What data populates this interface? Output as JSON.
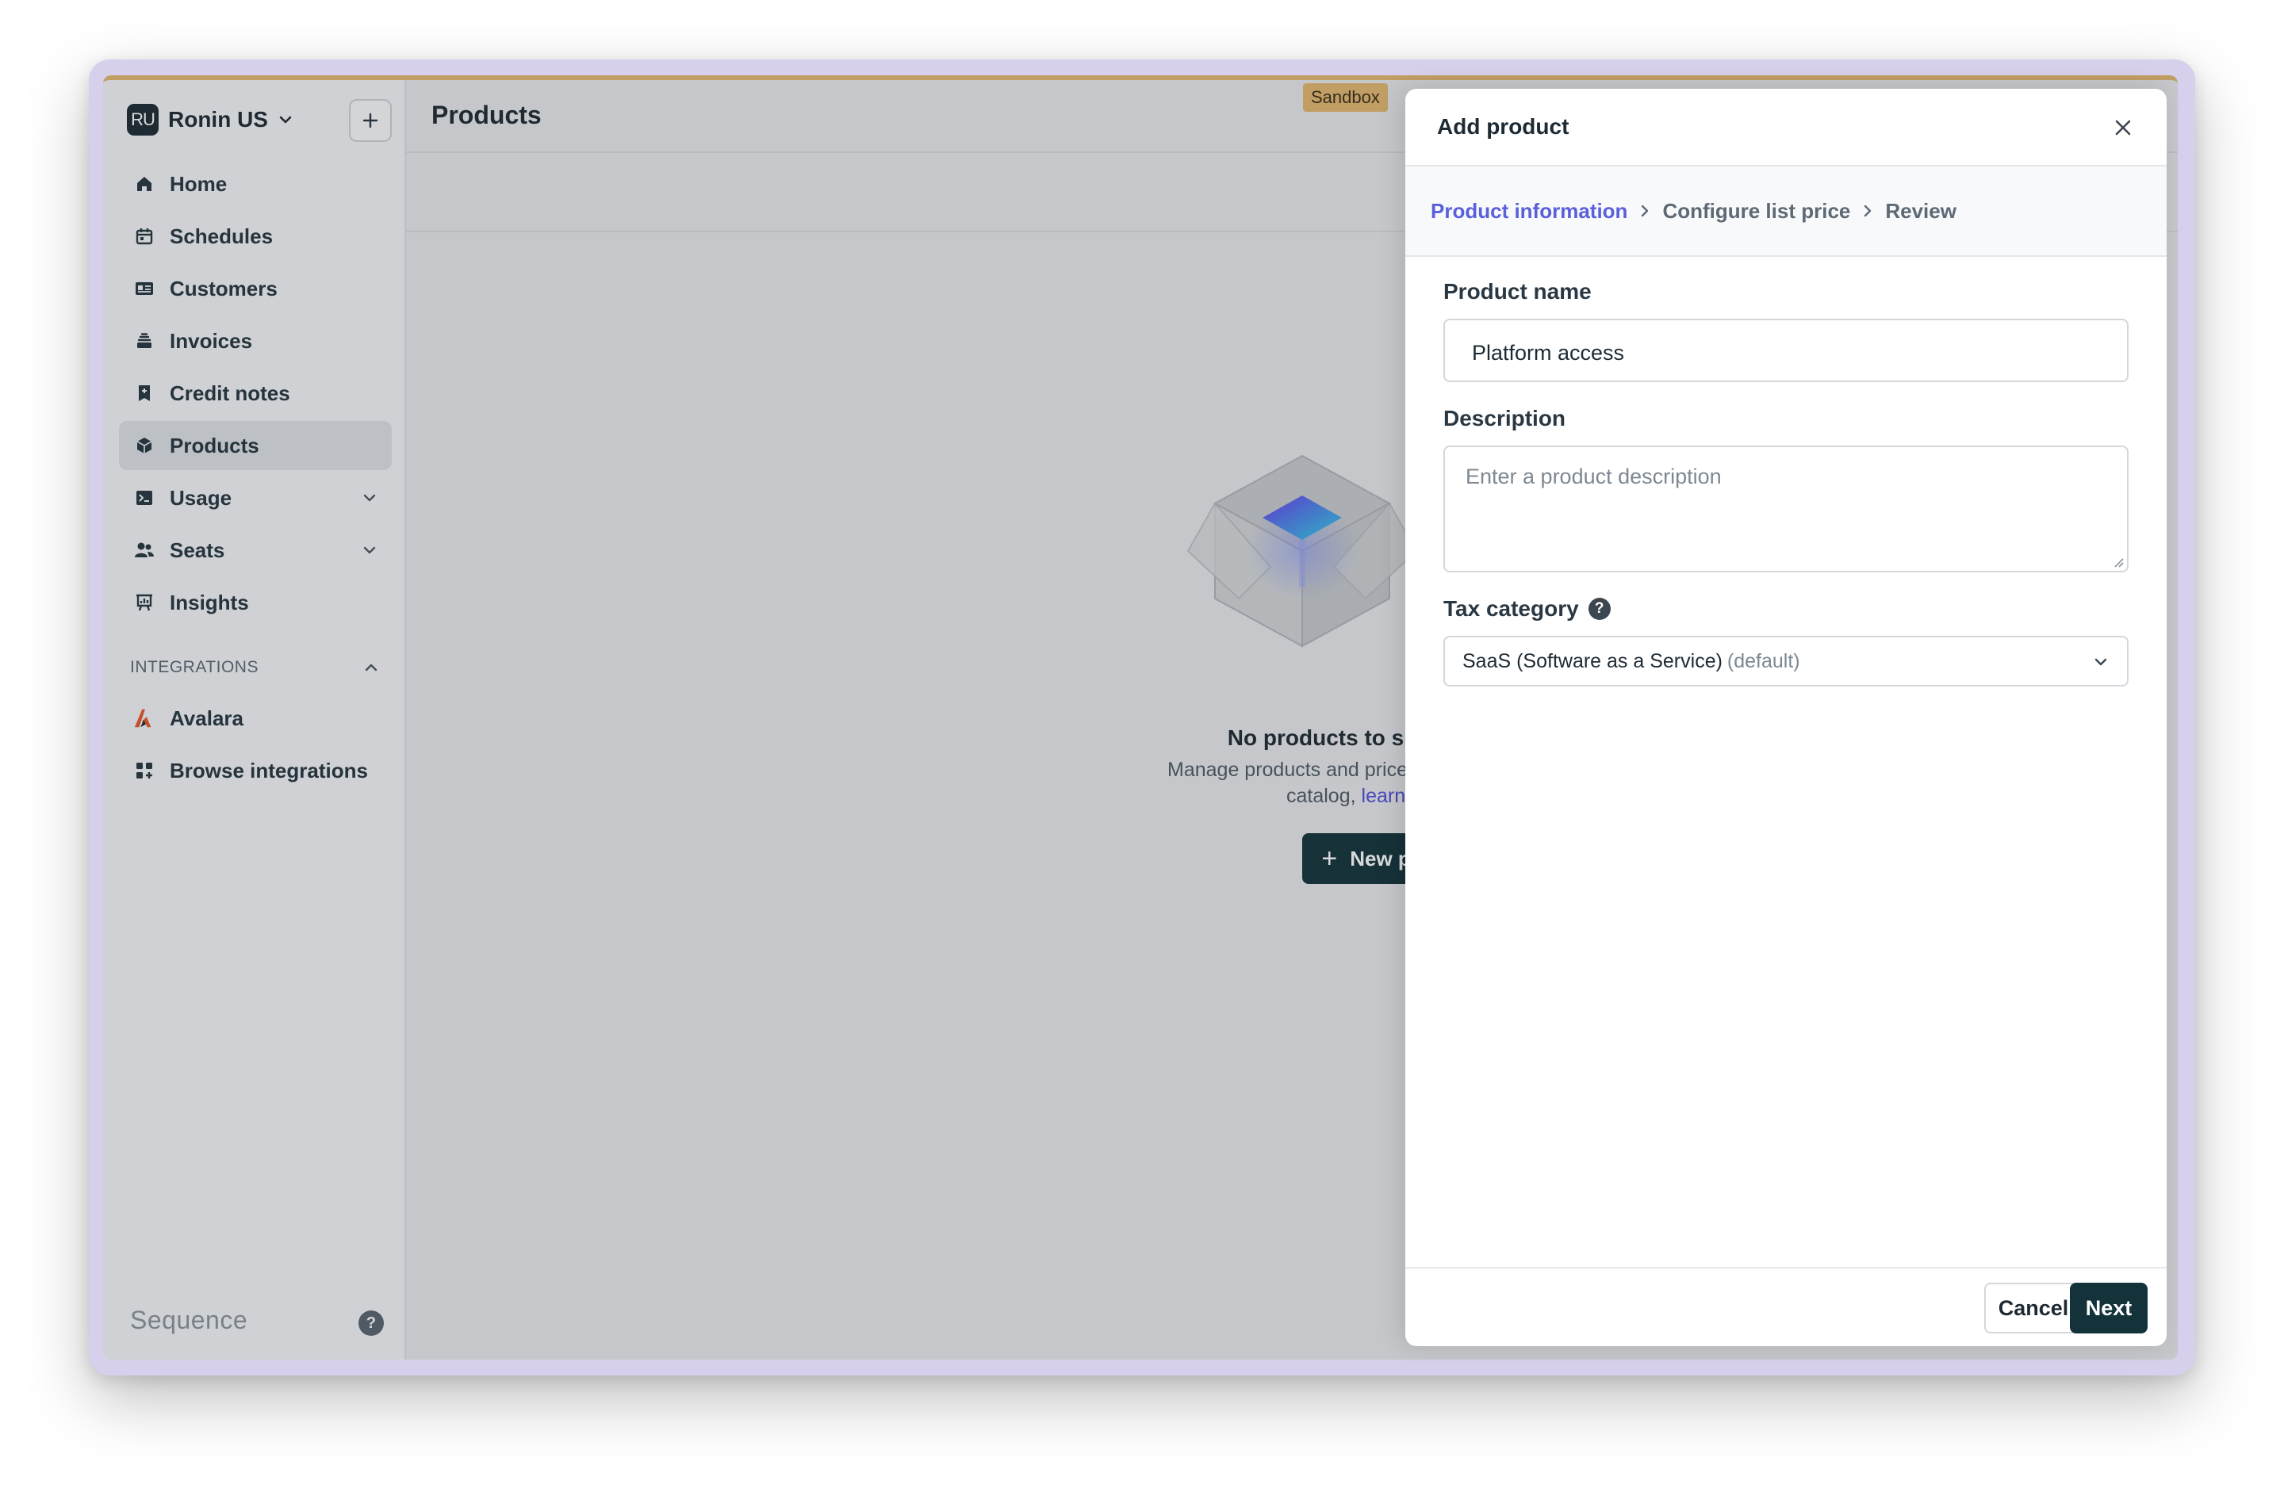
{
  "org": {
    "initials": "RU",
    "name": "Ronin US"
  },
  "sidebar": {
    "items": [
      {
        "label": "Home",
        "icon": "home-icon"
      },
      {
        "label": "Schedules",
        "icon": "calendar-icon"
      },
      {
        "label": "Customers",
        "icon": "id-card-icon"
      },
      {
        "label": "Invoices",
        "icon": "stack-icon"
      },
      {
        "label": "Credit notes",
        "icon": "receipt-icon"
      },
      {
        "label": "Products",
        "icon": "cube-icon",
        "active": true
      },
      {
        "label": "Usage",
        "icon": "terminal-icon",
        "expandable": true
      },
      {
        "label": "Seats",
        "icon": "users-icon",
        "expandable": true
      },
      {
        "label": "Insights",
        "icon": "chart-board-icon"
      }
    ],
    "integrations_title": "INTEGRATIONS",
    "integrations": [
      {
        "label": "Avalara",
        "icon": "avalara-logo-icon"
      },
      {
        "label": "Browse integrations",
        "icon": "grid-plus-icon"
      }
    ],
    "brand": "Sequence",
    "help": "?"
  },
  "header": {
    "title": "Products",
    "env_badge": "Sandbox"
  },
  "empty_state": {
    "title": "No products to show",
    "description": "Manage products and prices with th",
    "description_line2": "catalog, ",
    "link": "learn more",
    "button": "New product",
    "button_icon": "+"
  },
  "drawer": {
    "title": "Add product",
    "breadcrumb": [
      "Product information",
      "Configure list price",
      "Review"
    ],
    "product_name_label": "Product name",
    "product_name_value": "Platform access",
    "description_label": "Description",
    "description_placeholder": "Enter a product description",
    "tax_label": "Tax category",
    "tax_help": "?",
    "tax_value": "SaaS (Software as a Service)",
    "tax_value_suffix": "(default)",
    "cancel": "Cancel",
    "next": "Next"
  },
  "colors": {
    "accent": "#5a5fdc",
    "primary_button": "#13323a",
    "sandbox": "#e2b870"
  }
}
